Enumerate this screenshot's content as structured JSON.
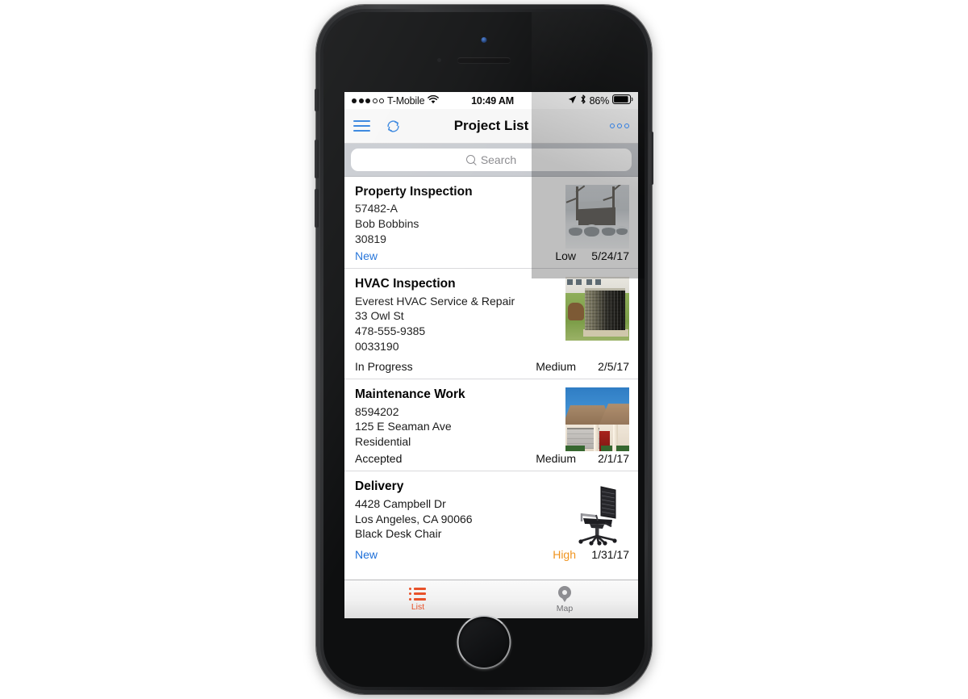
{
  "status_bar": {
    "signal_filled": 3,
    "signal_empty": 2,
    "carrier": "T-Mobile",
    "wifi_icon": "wifi-icon",
    "time": "10:49 AM",
    "location_icon": "location-arrow-icon",
    "bluetooth_icon": "bluetooth-icon",
    "battery_percent": "86%",
    "battery_icon": "battery-icon"
  },
  "nav_bar": {
    "menu_icon": "hamburger-menu-icon",
    "refresh_icon": "sync-refresh-icon",
    "title": "Project List",
    "more_icon": "more-options-icon"
  },
  "search": {
    "placeholder": "Search",
    "value": "",
    "icon": "search-icon"
  },
  "projects": [
    {
      "title": "Property Inspection",
      "lines": [
        "57482-A",
        "Bob Bobbins",
        "30819"
      ],
      "status": "New",
      "status_style": "new",
      "priority": "Low",
      "priority_style": "normal",
      "date": "5/24/17",
      "thumbnail": "snowy-house-photo"
    },
    {
      "title": "HVAC Inspection",
      "lines": [
        "Everest HVAC Service & Repair",
        "33 Owl St",
        "478-555-9385",
        "0033190"
      ],
      "status": "In Progress",
      "status_style": "plain",
      "priority": "Medium",
      "priority_style": "normal",
      "date": "2/5/17",
      "thumbnail": "hvac-condenser-photo"
    },
    {
      "title": "Maintenance Work",
      "lines": [
        "8594202",
        "125 E Seaman Ave",
        "Residential"
      ],
      "status": "Accepted",
      "status_style": "plain",
      "priority": "Medium",
      "priority_style": "normal",
      "date": "2/1/17",
      "thumbnail": "residential-house-photo"
    },
    {
      "title": "Delivery",
      "lines": [
        "4428 Campbell Dr",
        "Los Angeles, CA 90066",
        "Black Desk Chair"
      ],
      "status": "New",
      "status_style": "new",
      "priority": "High",
      "priority_style": "high",
      "date": "1/31/17",
      "thumbnail": "black-desk-chair-photo"
    }
  ],
  "tab_bar": [
    {
      "label": "List",
      "icon": "bulleted-list-icon",
      "active": true
    },
    {
      "label": "Map",
      "icon": "map-pin-icon",
      "active": false
    }
  ],
  "colors": {
    "accent_blue": "#2f7de1",
    "status_new": "#1d6fd8",
    "priority_high": "#f0941f",
    "tab_active": "#e8522a",
    "tab_inactive": "#6f6f72",
    "search_bar_bg": "#c9ccd1",
    "nav_bar_bg": "#f7f7f7"
  }
}
